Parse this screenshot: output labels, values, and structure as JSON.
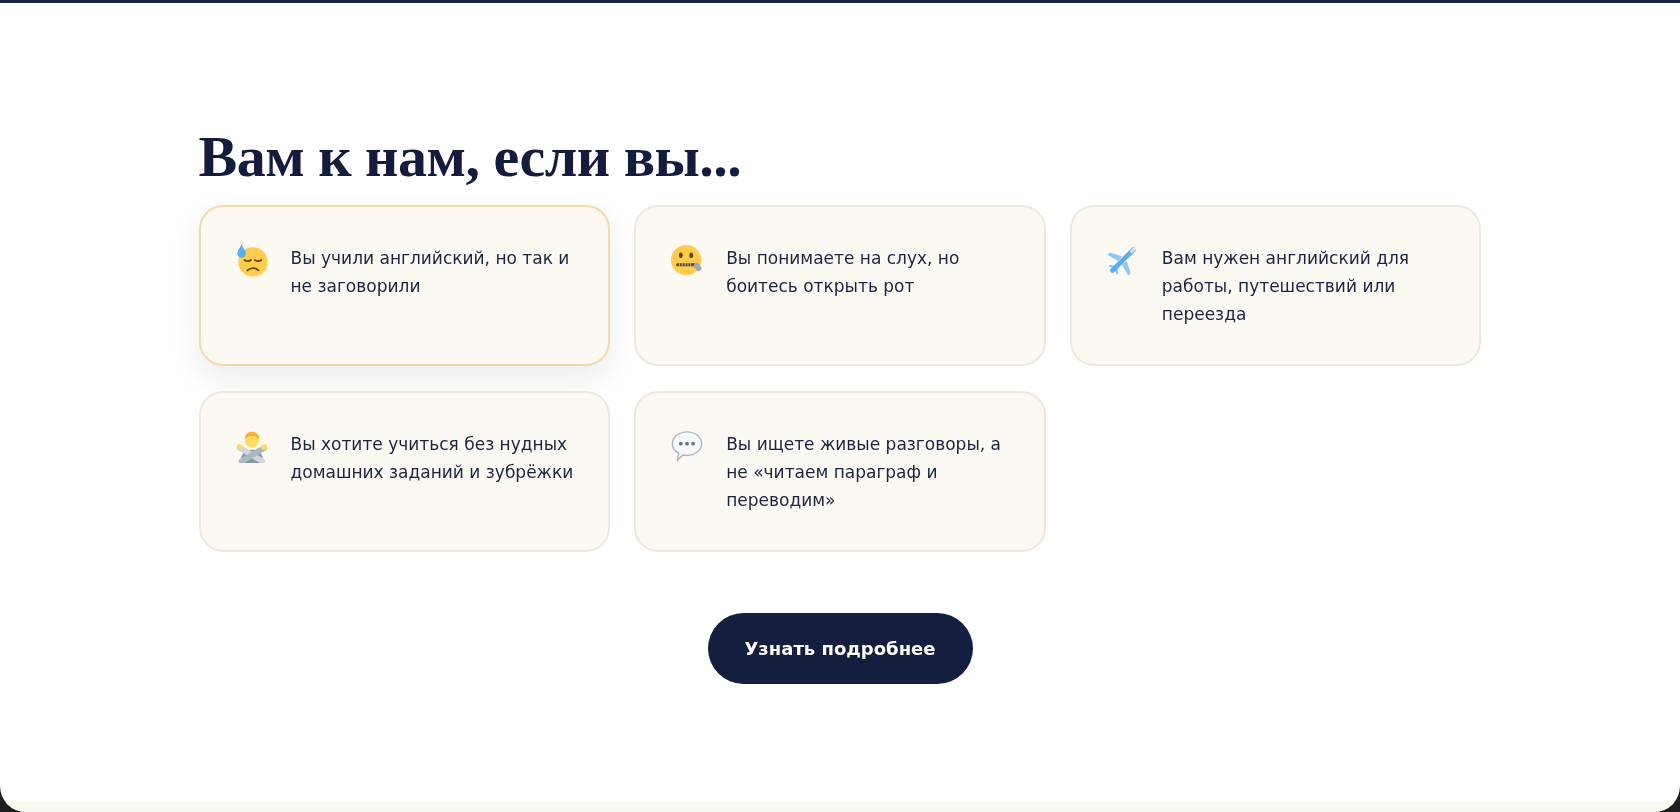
{
  "heading": "Вам к нам, если вы...",
  "cards": [
    {
      "text": "Вы учили английский, но так и не заговорили",
      "highlighted": true
    },
    {
      "text": "Вы понимаете на слух, но боитесь открыть рот",
      "highlighted": false
    },
    {
      "text": "Вам нужен английский для работы, путешествий или переезда",
      "highlighted": false
    },
    {
      "text": "Вы хотите учиться без нудных домашних заданий и зубрёжки",
      "highlighted": false
    },
    {
      "text": "Вы ищете живые разговоры, а не «читаем параграф и переводим»",
      "highlighted": false
    }
  ],
  "button": {
    "label": "Узнать подробнее"
  }
}
